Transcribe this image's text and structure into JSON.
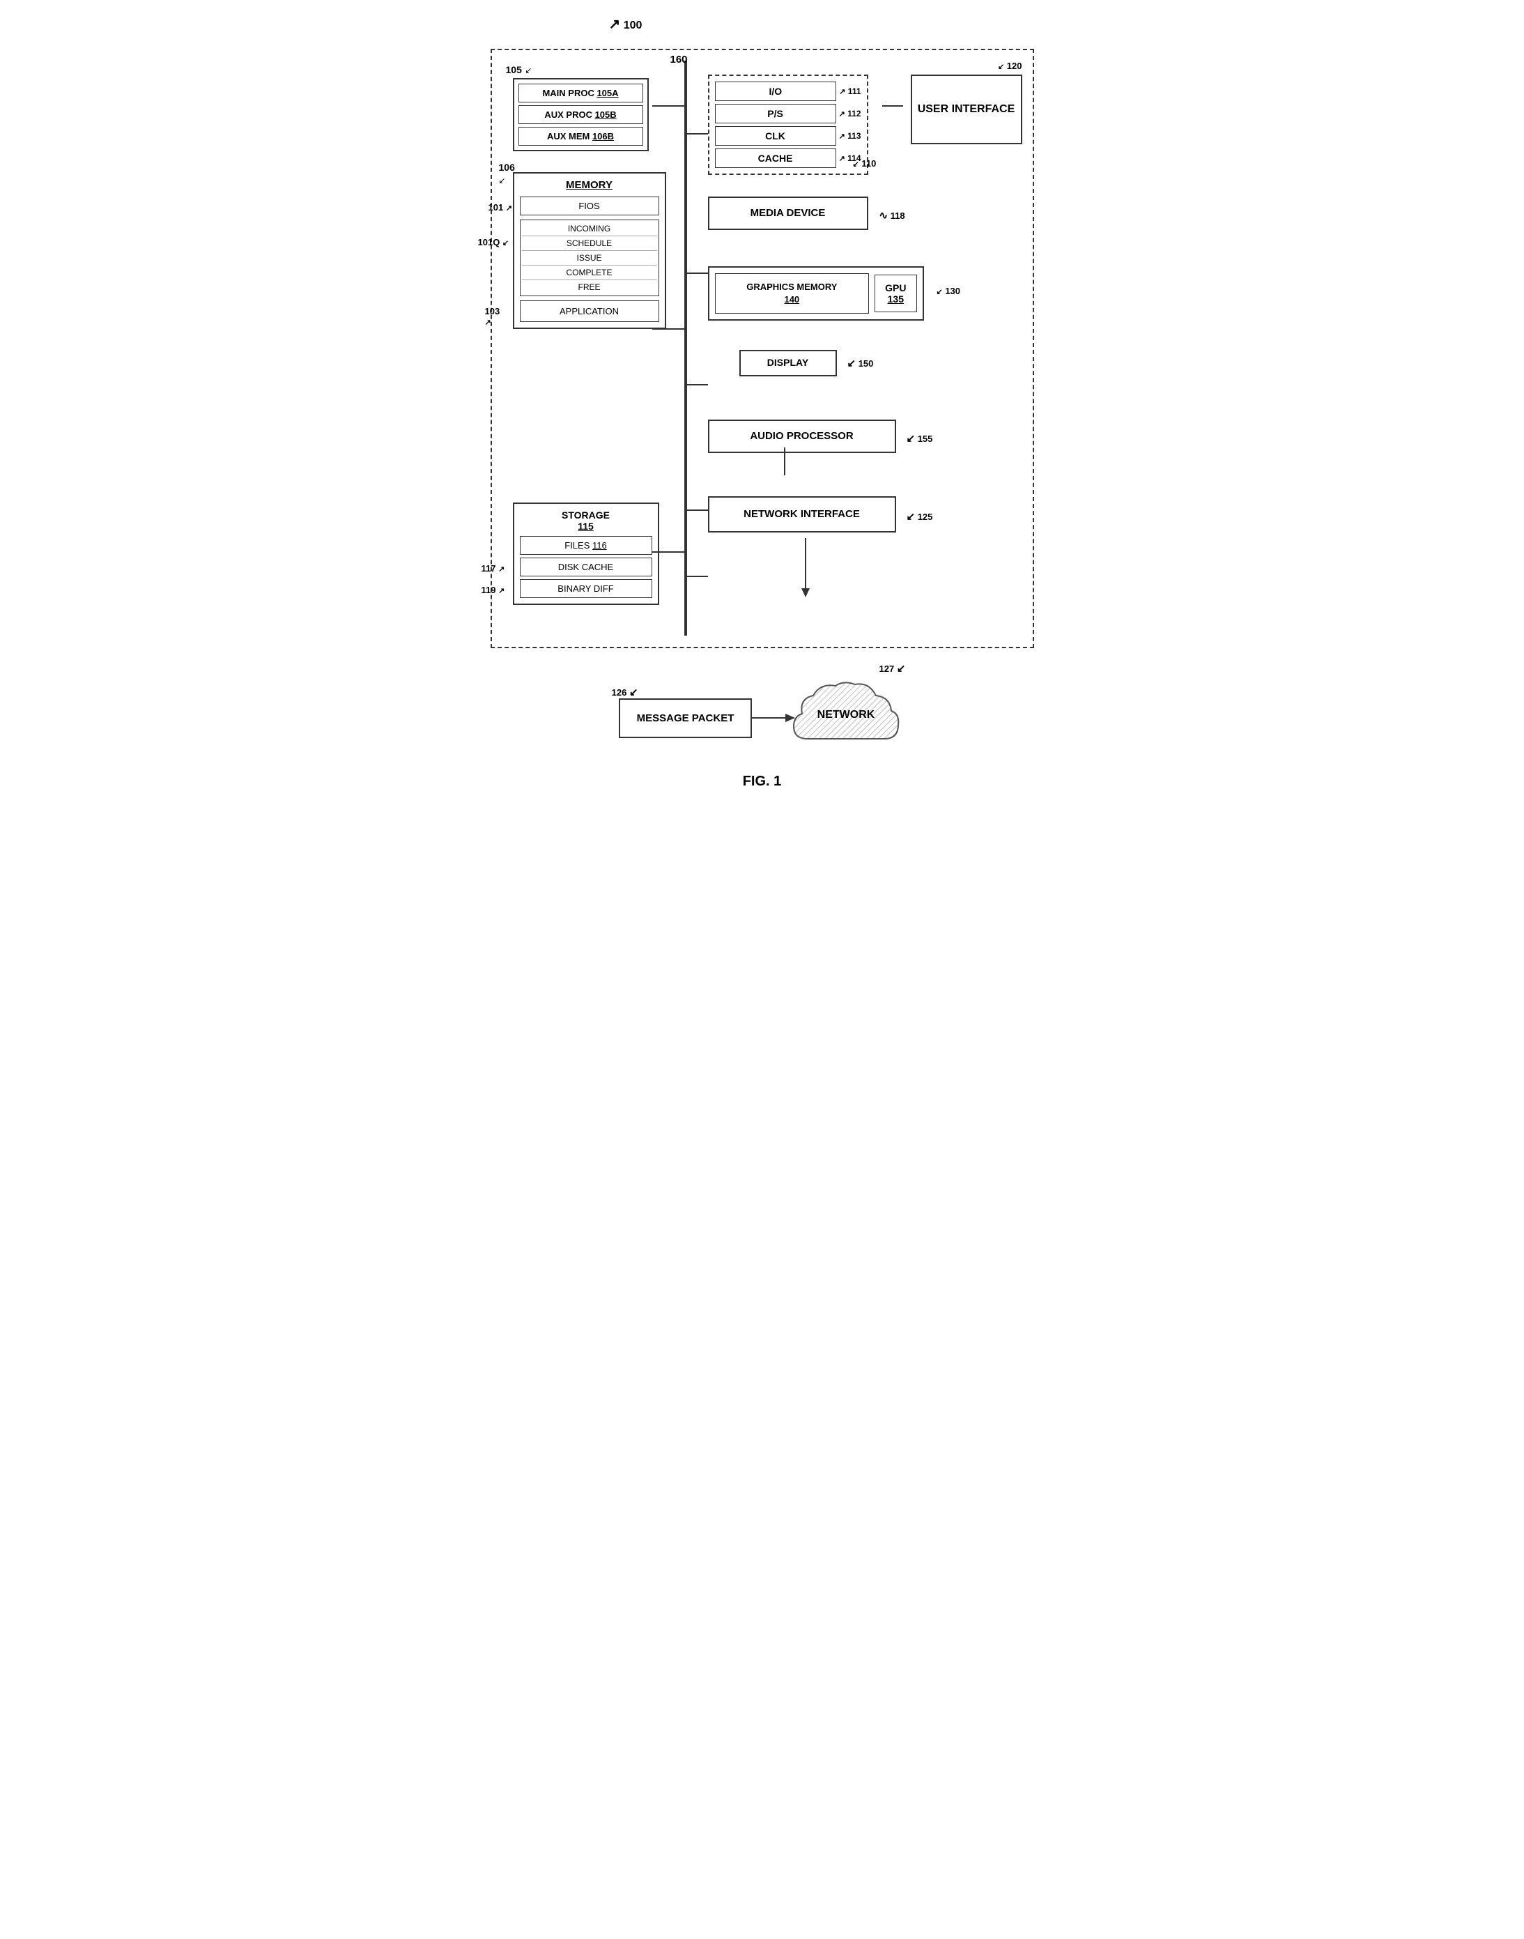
{
  "diagram": {
    "title": "FIG. 1",
    "ref_main": "100",
    "ref_bus": "160",
    "processor_group": {
      "ref": "105",
      "items": [
        {
          "label": "MAIN PROC ",
          "ref": "105A"
        },
        {
          "label": "AUX PROC ",
          "ref": "105B"
        },
        {
          "label": "AUX MEM ",
          "ref": "106B"
        }
      ]
    },
    "memory_block": {
      "ref": "106",
      "title": "MEMORY",
      "fios_ref": "101",
      "fios_label": "FIOS",
      "queue_ref": "101Q",
      "queue_items": [
        "INCOMING",
        "SCHEDULE",
        "ISSUE",
        "COMPLETE",
        "FREE"
      ],
      "app_ref": "103",
      "app_label": "APPLICATION"
    },
    "storage_block": {
      "ref": "115",
      "title_label": "STORAGE",
      "title_ref": "115",
      "files_label": "FILES ",
      "files_ref": "116",
      "disk_cache_ref": "117",
      "disk_cache_label": "DISK CACHE",
      "binary_diff_ref": "119",
      "binary_diff_label": "BINARY DIFF"
    },
    "chip_block": {
      "ref": "110",
      "items": [
        {
          "label": "I/O",
          "ref": "111"
        },
        {
          "label": "P/S",
          "ref": "112"
        },
        {
          "label": "CLK",
          "ref": "113"
        },
        {
          "label": "CACHE",
          "ref": "114"
        }
      ]
    },
    "user_interface": {
      "ref": "120",
      "label": "USER INTERFACE"
    },
    "media_device": {
      "ref": "118",
      "label": "MEDIA DEVICE"
    },
    "graphics_block": {
      "ref": "130",
      "graphics_memory_label": "GRAPHICS MEMORY",
      "graphics_memory_ref": "140",
      "gpu_label": "GPU",
      "gpu_ref": "135"
    },
    "display": {
      "ref": "150",
      "label": "DISPLAY"
    },
    "audio_processor": {
      "ref": "155",
      "label": "AUDIO PROCESSOR"
    },
    "network_interface": {
      "ref": "125",
      "label": "NETWORK INTERFACE"
    },
    "message_packet": {
      "ref": "126",
      "label": "MESSAGE PACKET"
    },
    "network": {
      "ref": "127",
      "label": "NETWORK"
    }
  }
}
